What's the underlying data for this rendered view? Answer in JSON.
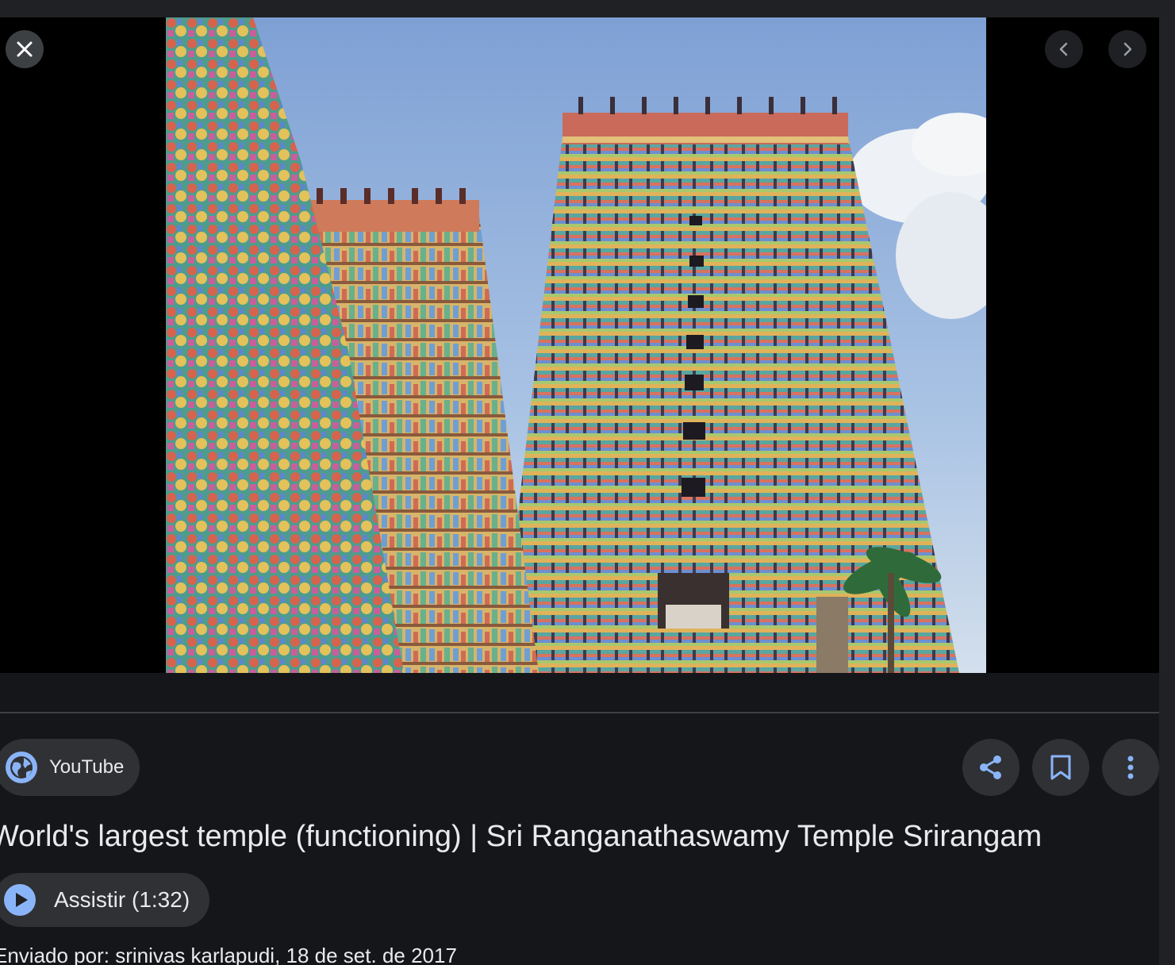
{
  "viewer": {
    "close_icon": "close-icon",
    "prev_icon": "chevron-left-icon",
    "next_icon": "chevron-right-icon"
  },
  "source": {
    "name": "YouTube",
    "icon": "globe-icon"
  },
  "actions": {
    "share_icon": "share-icon",
    "save_icon": "bookmark-icon",
    "more_icon": "more-vert-icon"
  },
  "result": {
    "title": "World's largest temple (functioning) | Sri Ranganathaswamy Temple Srirangam",
    "watch_label": "Assistir (1:32)",
    "meta": "Enviado por: srinivas karlapudi, 18 de set. de 2017"
  },
  "colors": {
    "accent": "#8ab4f8",
    "surface": "#303134",
    "text": "#e8eaed"
  }
}
